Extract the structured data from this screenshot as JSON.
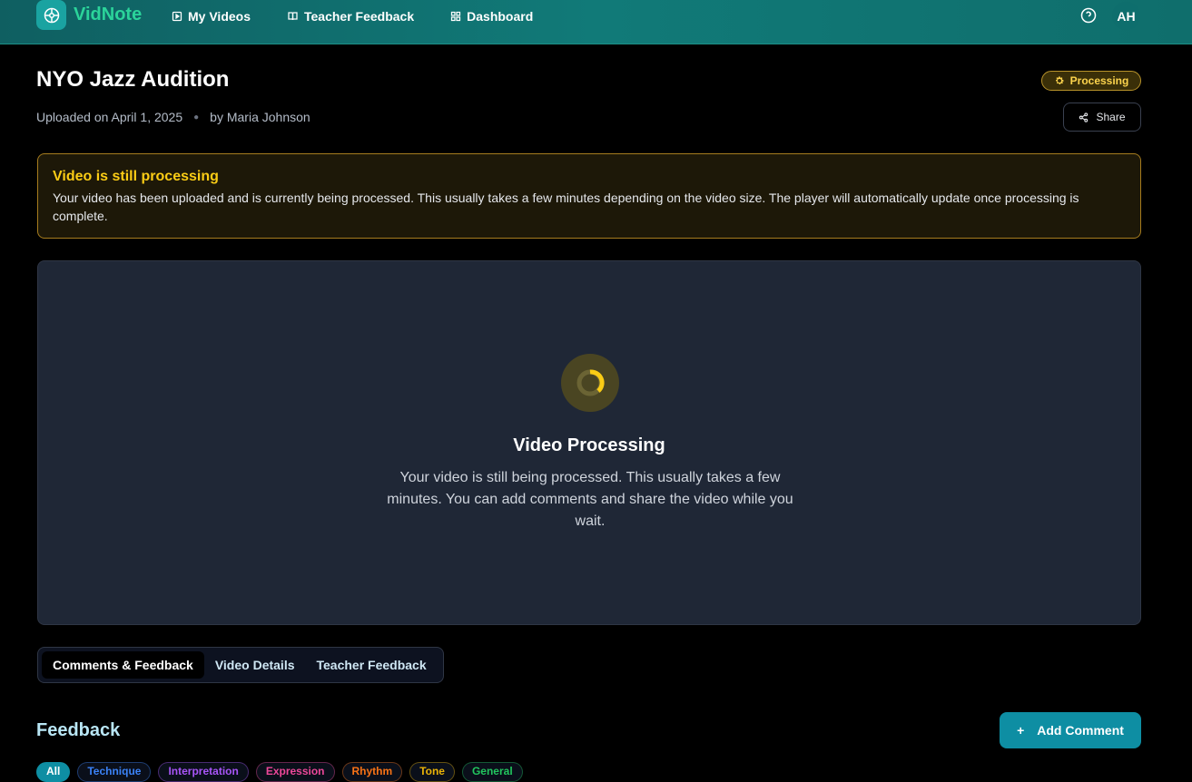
{
  "app": {
    "name": "VidNote"
  },
  "nav": {
    "items": [
      {
        "label": "My Videos",
        "icon": "play-square-icon"
      },
      {
        "label": "Teacher Feedback",
        "icon": "book-open-icon"
      },
      {
        "label": "Dashboard",
        "icon": "grid-icon"
      }
    ]
  },
  "user": {
    "initials": "AH"
  },
  "video": {
    "title": "NYO Jazz Audition",
    "uploaded": "Uploaded on April 1, 2025",
    "author": "by Maria Johnson",
    "status": "Processing"
  },
  "actions": {
    "share": "Share",
    "add_comment": "Add Comment"
  },
  "alert": {
    "title": "Video is still processing",
    "text": "Your video has been uploaded and is currently being processed. This usually takes a few minutes depending on the video size. The player will automatically update once processing is complete."
  },
  "player": {
    "title": "Video Processing",
    "text": "Your video is still being processed. This usually takes a few minutes. You can add comments and share the video while you wait."
  },
  "tabs": [
    {
      "label": "Comments & Feedback",
      "active": true
    },
    {
      "label": "Video Details",
      "active": false
    },
    {
      "label": "Teacher Feedback",
      "active": false
    }
  ],
  "feedback": {
    "title": "Feedback",
    "filters": [
      {
        "label": "All",
        "color": "#0e8ea3"
      },
      {
        "label": "Technique",
        "color": "#3b82f6"
      },
      {
        "label": "Interpretation",
        "color": "#a855f7"
      },
      {
        "label": "Expression",
        "color": "#ec4899"
      },
      {
        "label": "Rhythm",
        "color": "#f97316"
      },
      {
        "label": "Tone",
        "color": "#eab308"
      },
      {
        "label": "General",
        "color": "#22c55e"
      }
    ]
  },
  "colors": {
    "accent": "#0e8ea3",
    "header": "#117a78",
    "warning": "#facc15"
  }
}
